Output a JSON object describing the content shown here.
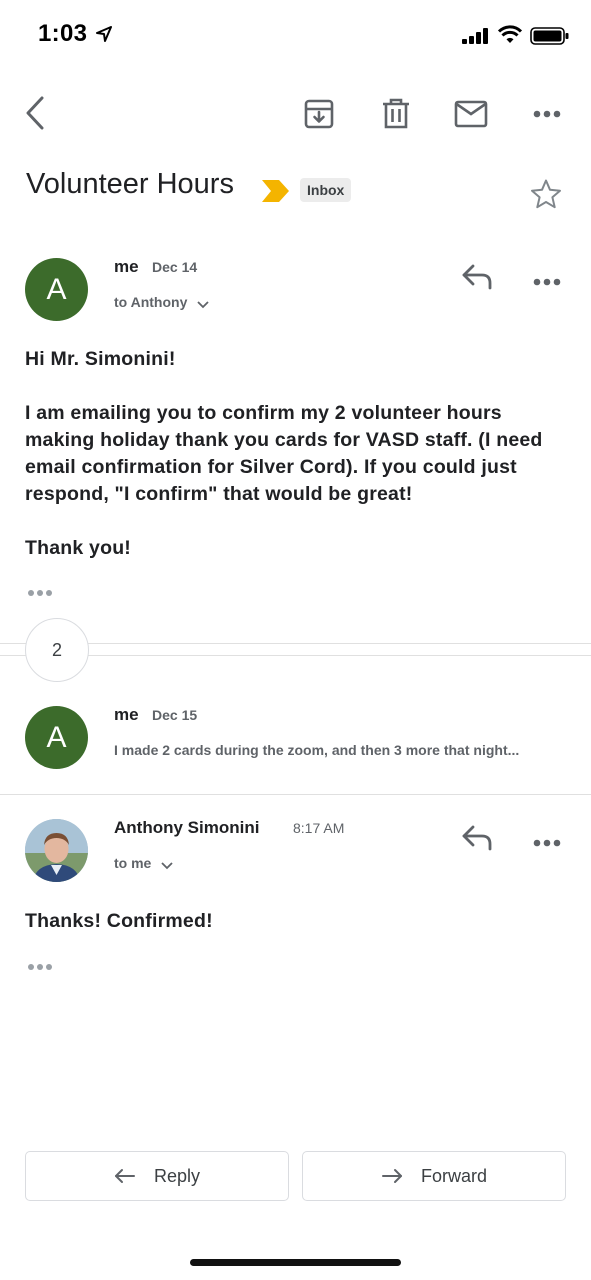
{
  "status_bar": {
    "time": "1:03"
  },
  "toolbar": {
    "back_icon": "chevron-left-icon",
    "archive_icon": "archive-icon",
    "delete_icon": "trash-icon",
    "mark_unread_icon": "mail-icon",
    "more_icon": "more-horizontal-icon"
  },
  "thread": {
    "subject": "Volunteer Hours",
    "label": "Inbox",
    "label_arrow_color": "#f4b400"
  },
  "messages": [
    {
      "avatar_letter": "A",
      "sender": "me",
      "date": "Dec 14",
      "to": "to Anthony",
      "body": [
        "Hi Mr. Simonini!",
        "I am emailing you to confirm my 2 volunteer hours making holiday thank you cards for VASD staff. (I need email confirmation for Silver Cord). If you could just respond, \"I confirm\" that would be great!",
        "Thank you!"
      ]
    },
    {
      "collapsed_count": "2"
    },
    {
      "avatar_letter": "A",
      "sender": "me",
      "date": "Dec 15",
      "snippet": "I made 2 cards during the zoom, and then 3 more that night..."
    },
    {
      "sender": "Anthony Simonini",
      "date": "8:17 AM",
      "to": "to me",
      "body": [
        "Thanks! Confirmed!"
      ]
    }
  ],
  "actions": {
    "reply": "Reply",
    "forward": "Forward"
  },
  "colors": {
    "avatar_green": "#3c6b2b"
  }
}
